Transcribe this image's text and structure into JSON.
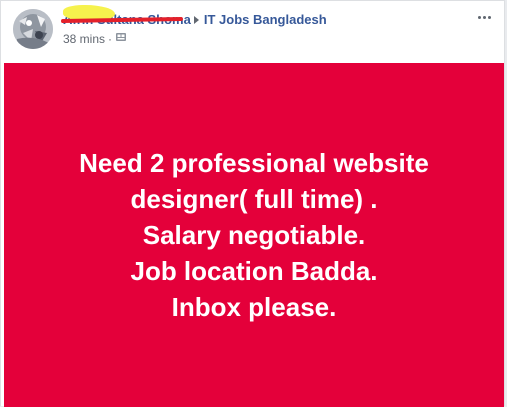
{
  "post": {
    "author": {
      "name": "Afrin Sultana Shoma",
      "redacted": true
    },
    "group": {
      "name": "IT Jobs Bangladesh"
    },
    "timestamp": "38 mins",
    "separator": "·",
    "audience_icon": "group-audience-icon",
    "more_icon": "more-options-icon",
    "content": {
      "background_color": "#e4003a",
      "text_color": "#ffffff",
      "lines": [
        "Need 2 professional website",
        "designer( full time) .",
        "Salary negotiable.",
        "Job location Badda.",
        "Inbox please."
      ]
    }
  },
  "colors": {
    "link": "#365899",
    "meta": "#616770",
    "redact_highlight": "#f6f24d",
    "redact_strike": "#e4202a"
  }
}
